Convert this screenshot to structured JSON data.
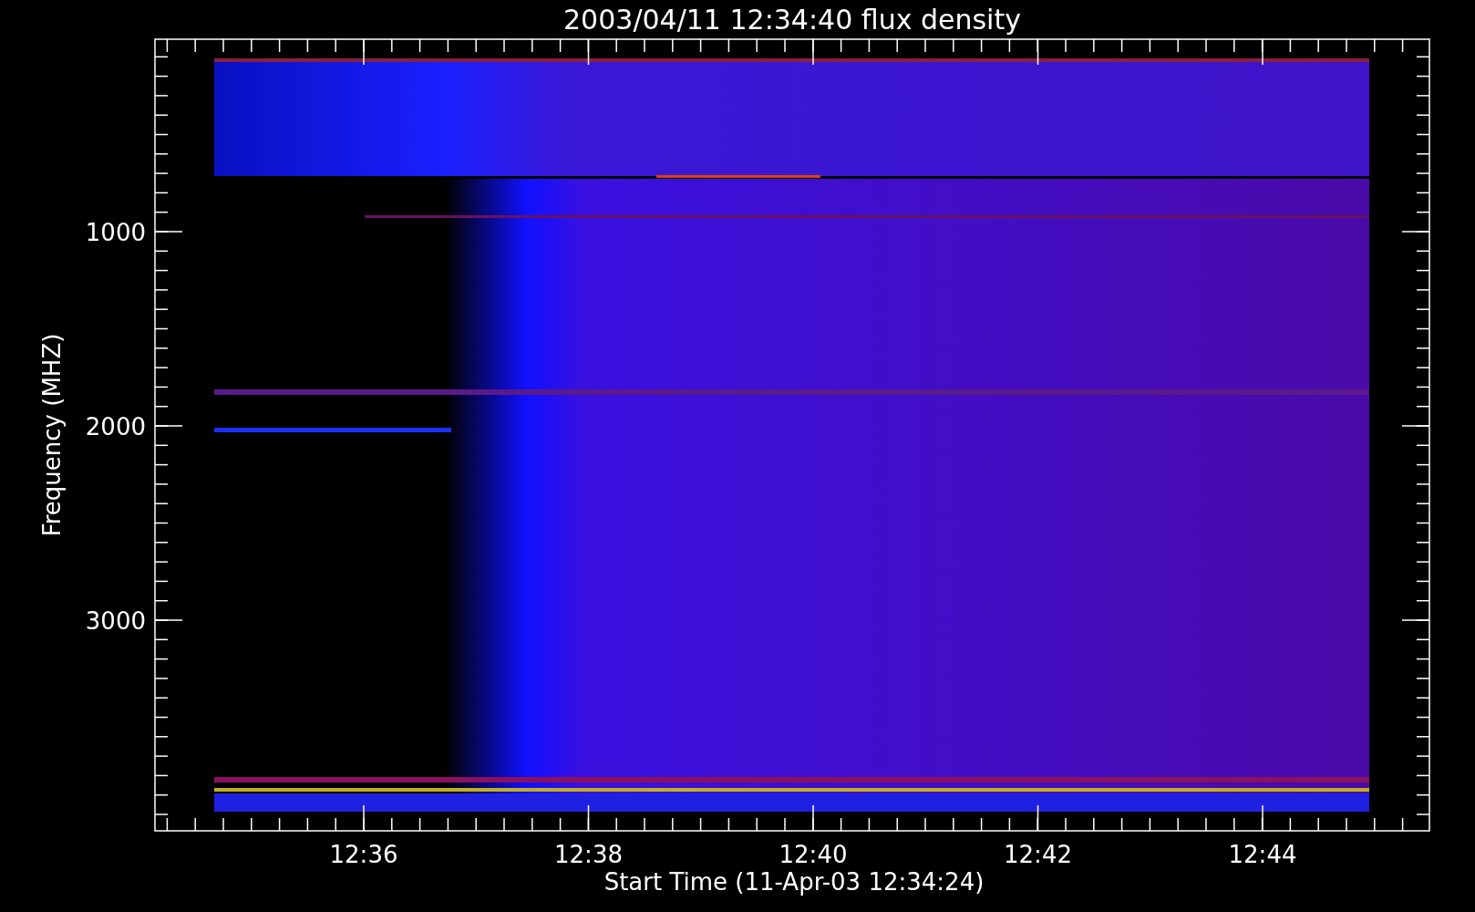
{
  "title": "2003/04/11 12:34:40 flux density",
  "y_axis": {
    "label": "Frequency (MHZ)",
    "ticks": [
      "1000",
      "2000",
      "3000"
    ]
  },
  "x_axis": {
    "label": "Start Time (11-Apr-03 12:34:24)",
    "ticks": [
      "12:36",
      "12:38",
      "12:40",
      "12:42",
      "12:44"
    ]
  }
}
